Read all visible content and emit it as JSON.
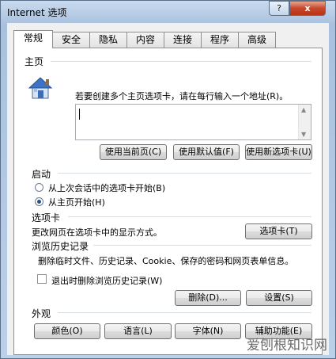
{
  "window": {
    "title": "Internet 选项",
    "help_label": "?",
    "close_label": "x"
  },
  "tabs": [
    "常规",
    "安全",
    "隐私",
    "内容",
    "连接",
    "程序",
    "高级"
  ],
  "home": {
    "heading": "主页",
    "description": "若要创建多个主页选项卡，请在每行输入一个地址(R)。",
    "address_value": "",
    "btn_current": "使用当前页(C)",
    "btn_default": "使用默认值(F)",
    "btn_newtab": "使用新选项卡(U)"
  },
  "startup": {
    "heading": "启动",
    "option_last_session": "从上次会话中的选项卡开始(B)",
    "option_home": "从主页开始(H)",
    "selected": "从主页开始(H)"
  },
  "tabsection": {
    "heading": "选项卡",
    "description": "更改网页在选项卡中的显示方式。",
    "btn_tabs": "选项卡(T)"
  },
  "history": {
    "heading": "浏览历史记录",
    "description": "删除临时文件、历史记录、Cookie、保存的密码和网页表单信息。",
    "checkbox_label": "退出时删除浏览历史记录(W)",
    "checkbox_checked": false,
    "btn_delete": "删除(D)...",
    "btn_settings": "设置(S)"
  },
  "appearance": {
    "heading": "外观",
    "btn_colors": "颜色(O)",
    "btn_languages": "语言(L)",
    "btn_fonts": "字体(N)",
    "btn_accessibility": "辅助功能(E)"
  },
  "watermark": "爱刨根知识网",
  "icons": {
    "home": "house-icon"
  }
}
